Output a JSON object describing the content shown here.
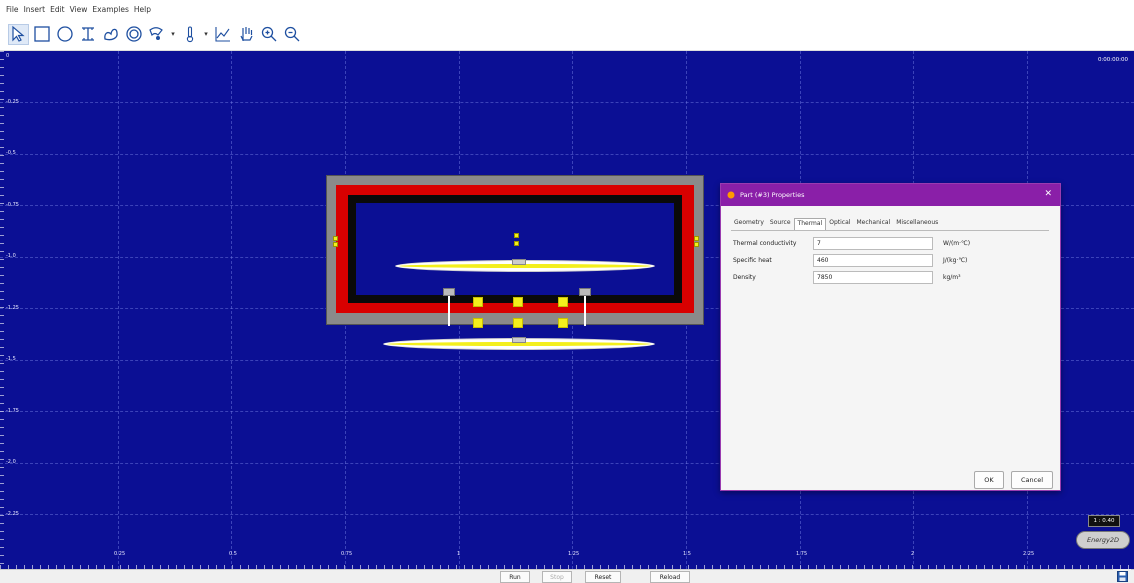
{
  "menu": [
    "File",
    "Insert",
    "Edit",
    "View",
    "Examples",
    "Help"
  ],
  "toolbar": {
    "tools": [
      "select-arrow-icon",
      "rectangle-icon",
      "ellipse-icon",
      "text-cursor-icon",
      "blob-icon",
      "ring-icon",
      "fan-icon",
      "thermometer-icon",
      "graph-icon",
      "hand-icon",
      "zoom-in-icon",
      "zoom-out-icon"
    ]
  },
  "canvas": {
    "timer": "0:00:00:00",
    "y_labels": [
      "0",
      "-0.25",
      "-0.5",
      "-0.75",
      "-1.0",
      "-1.25",
      "-1.5",
      "-1.75",
      "-2.0",
      "-2.25"
    ],
    "x_labels": [
      "0.25",
      "0.5",
      "0.75",
      "1",
      "1.25",
      "1.5",
      "1.75",
      "2",
      "2.25"
    ],
    "background_color": "#0b0f94"
  },
  "dialog": {
    "title": "Part (#3) Properties",
    "tabs": [
      "Geometry",
      "Source",
      "Thermal",
      "Optical",
      "Mechanical",
      "Miscellaneous"
    ],
    "active_tab": "Thermal",
    "rows": [
      {
        "label": "Thermal conductivity",
        "value": "7",
        "unit": "W/(m·℃)"
      },
      {
        "label": "Specific heat",
        "value": "460",
        "unit": "J/(kg·℃)"
      },
      {
        "label": "Density",
        "value": "7850",
        "unit": "kg/m³"
      }
    ],
    "ok_label": "OK",
    "cancel_label": "Cancel"
  },
  "indicators": {
    "scale": "1 : 0.40",
    "logo": "Energy2D"
  },
  "bottombar": {
    "run": "Run",
    "stop": "Stop",
    "reset": "Reset",
    "reload": "Reload"
  }
}
